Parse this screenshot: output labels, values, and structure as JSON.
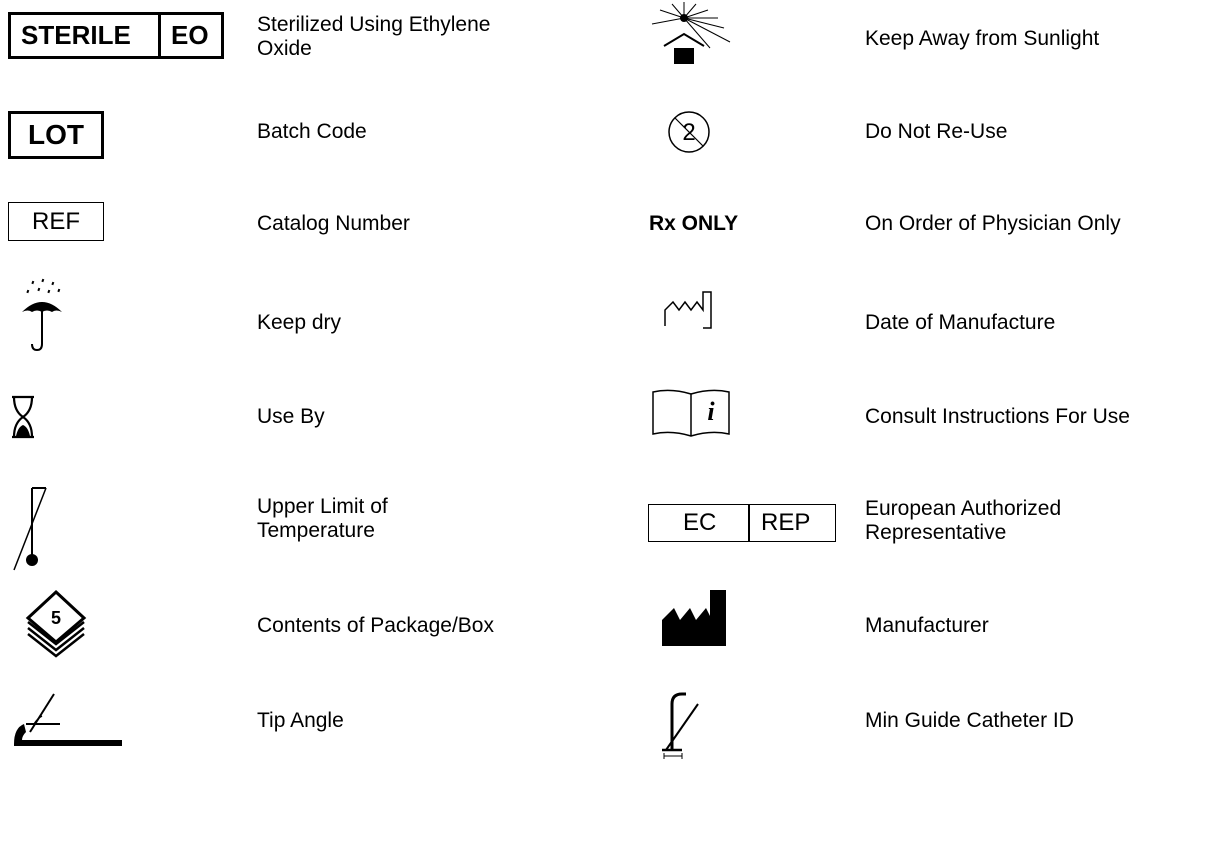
{
  "left": [
    {
      "label": "Sterilized Using Ethylene\nOxide",
      "symbol": "sterile-eo",
      "symbol_text": [
        "STERILE",
        "EO"
      ]
    },
    {
      "label": "Batch Code",
      "symbol": "lot",
      "symbol_text": [
        "LOT"
      ]
    },
    {
      "label": "Catalog Number",
      "symbol": "ref",
      "symbol_text": [
        "REF"
      ]
    },
    {
      "label": "Keep dry",
      "symbol": "umbrella-icon"
    },
    {
      "label": "Use By",
      "symbol": "hourglass-icon"
    },
    {
      "label": "Upper Limit of\nTemperature",
      "symbol": "thermometer-icon"
    },
    {
      "label": "Contents of Package/Box",
      "symbol": "package-contents-icon",
      "symbol_text": [
        "5"
      ]
    },
    {
      "label": "Tip Angle",
      "symbol": "tip-angle-icon"
    }
  ],
  "right": [
    {
      "label": "Keep Away from Sunlight",
      "symbol": "sun-icon"
    },
    {
      "label": "Do Not Re-Use",
      "symbol": "do-not-reuse-icon"
    },
    {
      "label": "On Order of Physician Only",
      "symbol": "rx-only",
      "symbol_text": [
        "Rx ONLY"
      ]
    },
    {
      "label": "Date of Manufacture",
      "symbol": "date-of-manufacture-icon"
    },
    {
      "label": "Consult Instructions For Use",
      "symbol": "instructions-icon",
      "symbol_text": [
        "i"
      ]
    },
    {
      "label": "European Authorized\nRepresentative",
      "symbol": "ec-rep",
      "symbol_text": [
        "EC",
        "REP"
      ]
    },
    {
      "label": "Manufacturer",
      "symbol": "manufacturer-icon"
    },
    {
      "label": "Min Guide Catheter ID",
      "symbol": "guide-catheter-icon"
    }
  ]
}
